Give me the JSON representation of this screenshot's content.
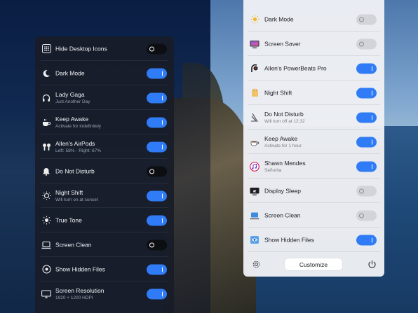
{
  "dark_panel": {
    "items": [
      {
        "title": "Hide Desktop Icons",
        "subtitle": "",
        "icon": "grid-icon",
        "state": "off"
      },
      {
        "title": "Dark Mode",
        "subtitle": "",
        "icon": "moon-icon",
        "state": "on"
      },
      {
        "title": "Lady Gaga",
        "subtitle": "Just Another Day",
        "icon": "headphones-icon",
        "state": "on"
      },
      {
        "title": "Keep Awake",
        "subtitle": "Activate for indefinitely",
        "icon": "coffee-icon",
        "state": "on"
      },
      {
        "title": "Allen's AirPods",
        "subtitle": "Left: 58% - Right: 67%",
        "icon": "airpods-icon",
        "state": "on"
      },
      {
        "title": "Do Not Disturb",
        "subtitle": "",
        "icon": "bell-icon",
        "state": "off"
      },
      {
        "title": "Night Shift",
        "subtitle": "Will turn on at sunset",
        "icon": "night-shift-icon",
        "state": "on"
      },
      {
        "title": "True Tone",
        "subtitle": "",
        "icon": "sun-icon",
        "state": "on"
      },
      {
        "title": "Screen Clean",
        "subtitle": "",
        "icon": "laptop-icon",
        "state": "off"
      },
      {
        "title": "Show Hidden Files",
        "subtitle": "",
        "icon": "eye-icon",
        "state": "on"
      },
      {
        "title": "Screen Resolution",
        "subtitle": "1920 × 1200 HDPI",
        "icon": "display-icon",
        "state": "on"
      }
    ]
  },
  "light_panel": {
    "items": [
      {
        "title": "Dark Mode",
        "subtitle": "",
        "icon": "sun-moon-icon",
        "state": "off"
      },
      {
        "title": "Screen Saver",
        "subtitle": "",
        "icon": "screen-saver-icon",
        "state": "off"
      },
      {
        "title": "Allen's PowerBeats Pro",
        "subtitle": "",
        "icon": "earbud-icon",
        "state": "on"
      },
      {
        "title": "Night Shift",
        "subtitle": "",
        "icon": "night-shift-icon",
        "state": "on"
      },
      {
        "title": "Do Not Disturb",
        "subtitle": "Will turn off at 12:32",
        "icon": "moon-icon",
        "state": "on"
      },
      {
        "title": "Keep Awake",
        "subtitle": "Activate for 1 hour",
        "icon": "coffee-icon",
        "state": "on"
      },
      {
        "title": "Shawn Mendes",
        "subtitle": "Señorita",
        "icon": "music-icon",
        "state": "on"
      },
      {
        "title": "Display Sleep",
        "subtitle": "",
        "icon": "display-sleep-icon",
        "state": "off"
      },
      {
        "title": "Screen Clean",
        "subtitle": "",
        "icon": "laptop-icon",
        "state": "off"
      },
      {
        "title": "Show Hidden Files",
        "subtitle": "",
        "icon": "eye-icon",
        "state": "on"
      }
    ],
    "footer": {
      "customize_label": "Customize",
      "settings_icon": "gear-icon",
      "power_icon": "power-icon"
    }
  },
  "colors": {
    "accent": "#2f7cf6",
    "dark_panel_bg": "#181c28",
    "light_panel_bg": "#eef0f4"
  }
}
